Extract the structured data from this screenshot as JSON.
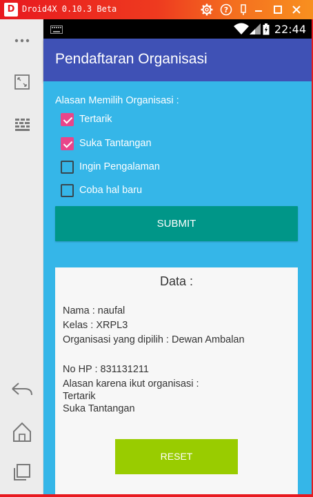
{
  "window": {
    "logo_text": "D",
    "title": "Droid4X 0.10.3 Beta",
    "controls": [
      "gear-icon",
      "help-icon",
      "pin-icon",
      "minimize-icon",
      "maximize-icon",
      "close-icon"
    ]
  },
  "status_bar": {
    "time": "22:44",
    "icons": [
      "keyboard-icon",
      "wifi-icon",
      "signal-icon",
      "battery-icon"
    ]
  },
  "app_bar": {
    "title": "Pendaftaran Organisasi"
  },
  "form": {
    "question": "Alasan Memilih Organisasi :",
    "options": [
      {
        "label": "Tertarik",
        "checked": true
      },
      {
        "label": "Suka Tantangan",
        "checked": true
      },
      {
        "label": "Ingin Pengalaman",
        "checked": false
      },
      {
        "label": "Coba hal baru",
        "checked": false
      }
    ],
    "submit_label": "SUBMIT"
  },
  "result": {
    "heading": "Data :",
    "nama": "Nama : naufal",
    "kelas": "Kelas :  XRPL3",
    "organisasi": "Organisasi yang dipilih  :  Dewan Ambalan",
    "no_hp": "No HP   : 831131211",
    "alasan_label": "Alasan karena ikut organisasi  :",
    "alasan_values": [
      "Tertarik",
      "Suka Tantangan"
    ],
    "reset_label": "RESET"
  },
  "colors": {
    "title_bar_start": "#e8191f",
    "title_bar_end": "#f8901f",
    "app_bar": "#3f51b5",
    "background": "#35b6e8",
    "checkbox_checked": "#e9458a",
    "submit_button": "#009688",
    "reset_button": "#99cc00"
  }
}
